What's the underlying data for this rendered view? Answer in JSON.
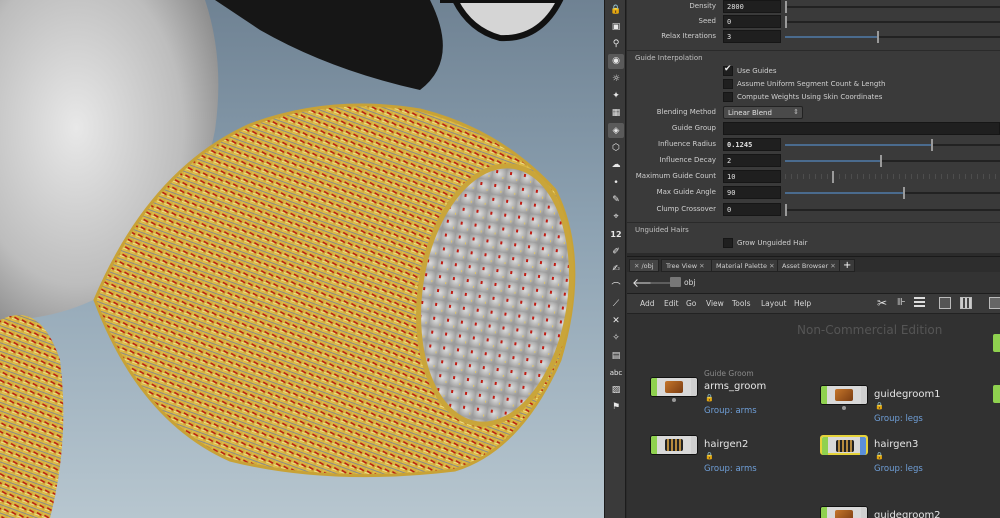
{
  "parameters": {
    "rows": [
      {
        "label": "Density",
        "value": "2800",
        "fill": 0.0
      },
      {
        "label": "Seed",
        "value": "0",
        "fill": 0.0
      },
      {
        "label": "Relax Iterations",
        "value": "3",
        "fill": 0.43
      }
    ],
    "guide_interpolation": {
      "title": "Guide Interpolation",
      "use_guides": {
        "label": "Use Guides",
        "checked": true
      },
      "uniform": {
        "label": "Assume Uniform Segment Count & Length",
        "checked": false
      },
      "weights": {
        "label": "Compute Weights Using Skin Coordinates",
        "checked": false
      },
      "blending_method": {
        "label": "Blending Method",
        "value": "Linear Blend"
      },
      "guide_group": {
        "label": "Guide Group",
        "value": ""
      },
      "influence_radius": {
        "label": "Influence Radius",
        "value": "0.1245",
        "fill": 0.68
      },
      "influence_decay": {
        "label": "Influence Decay",
        "value": "2",
        "fill": 0.44
      },
      "max_guide_count": {
        "label": "Maximum Guide Count",
        "value": "10",
        "fill": 0.22
      },
      "max_guide_angle": {
        "label": "Max Guide Angle",
        "value": "90",
        "fill": 0.55
      },
      "clump_crossover": {
        "label": "Clump Crossover",
        "value": "0",
        "fill": 0.0
      }
    },
    "unguided": {
      "title": "Unguided Hairs",
      "grow": {
        "label": "Grow Unguided Hair",
        "checked": false
      }
    }
  },
  "tabs": [
    {
      "label": "/obj",
      "active": true
    },
    {
      "label": "Tree View",
      "active": false
    },
    {
      "label": "Material Palette",
      "active": false
    },
    {
      "label": "Asset Browser",
      "active": false
    }
  ],
  "path": "obj",
  "menu": [
    "Add",
    "Edit",
    "Go",
    "View",
    "Tools",
    "Layout",
    "Help"
  ],
  "network": {
    "watermark": "Non-Commercial Edition",
    "nodes": [
      {
        "name": "arms_groom",
        "type_label": "Guide Groom",
        "group": "Group: arms",
        "icon": "groom-brush-icon"
      },
      {
        "name": "guidegroom1",
        "type_label": "",
        "group": "Group: legs",
        "icon": "groom-brush-icon"
      },
      {
        "name": "hairgen2",
        "type_label": "",
        "group": "Group: arms",
        "icon": "hairgen-icon"
      },
      {
        "name": "hairgen3",
        "type_label": "",
        "group": "Group: legs",
        "icon": "hairgen-icon",
        "selected": true
      },
      {
        "name": "guidegroom2",
        "type_label": "",
        "group": "",
        "icon": "groom-brush-icon"
      }
    ]
  },
  "toolstrip": [
    "lock-icon",
    "display-icon",
    "snap-icon",
    "light-icon",
    "bulb-icon",
    "lightbulb-icon",
    "render-icon",
    "camera-icon",
    "wireframe-icon",
    "ghost-icon",
    "dot-icon",
    "pen-icon",
    "pin-icon",
    "number-12-icon",
    "brush-icon",
    "paint-icon",
    "curve-icon",
    "bone-icon",
    "joint-icon",
    "capture-icon",
    "texture-icon",
    "abc-icon",
    "image-icon",
    "map-pin-icon"
  ],
  "toolstrip_text": {
    "number": "12",
    "abc": "abc"
  }
}
